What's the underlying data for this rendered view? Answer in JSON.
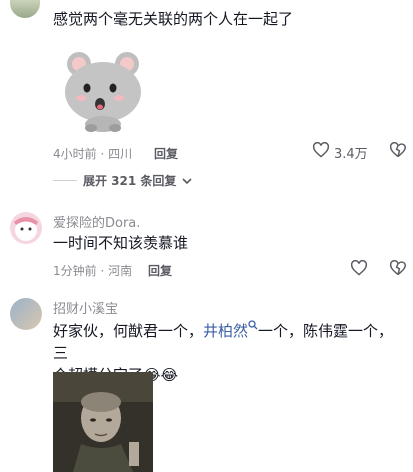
{
  "comment1": {
    "text": "感觉两个毫无关联的两个人在一起了",
    "sticker": "hamster-sticker",
    "time": "4小时前 · 四川",
    "reply_label": "回复",
    "likes": "3.4万"
  },
  "expand": {
    "label": "展开 321 条回复"
  },
  "comment2": {
    "username": "爱探险的Dora.",
    "text": "一时间不知该羡慕谁",
    "time": "1分钟前 · 河南",
    "reply_label": "回复"
  },
  "comment3": {
    "username": "招财小溪宝",
    "text_before": "好家伙，何猷君一个，",
    "link_text": "井柏然",
    "text_after_link": "一个，陈伟霆一个，三",
    "text_line2": "个超模分完了",
    "emoji": "😂😂"
  },
  "colors": {
    "link": "#3b5fa7",
    "meta": "#8a8b91",
    "text": "#161823"
  }
}
